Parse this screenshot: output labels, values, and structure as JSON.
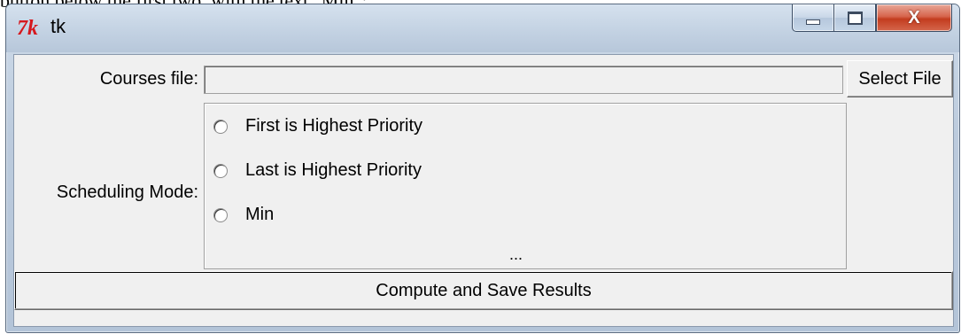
{
  "context_text": "button below the first two, with the text \"Min\":",
  "window": {
    "icon_glyph": "7k",
    "title": "tk",
    "close_glyph": "X"
  },
  "form": {
    "courses_label": "Courses file:",
    "courses_value": "",
    "select_file_label": "Select File",
    "scheduling_label": "Scheduling Mode:",
    "radio_options": [
      {
        "label": "First is Highest Priority",
        "selected": false
      },
      {
        "label": "Last is Highest Priority",
        "selected": false
      },
      {
        "label": "Min",
        "selected": false
      }
    ],
    "ellipsis": "...",
    "compute_label": "Compute and Save Results"
  },
  "colors": {
    "tk_icon": "#d6181e",
    "close_button": "#c33c1f",
    "client_bg": "#f0f0f0"
  },
  "icons": {
    "app": "tk-feather-icon",
    "minimize": "minimize-icon",
    "maximize": "maximize-icon",
    "close": "close-icon"
  }
}
